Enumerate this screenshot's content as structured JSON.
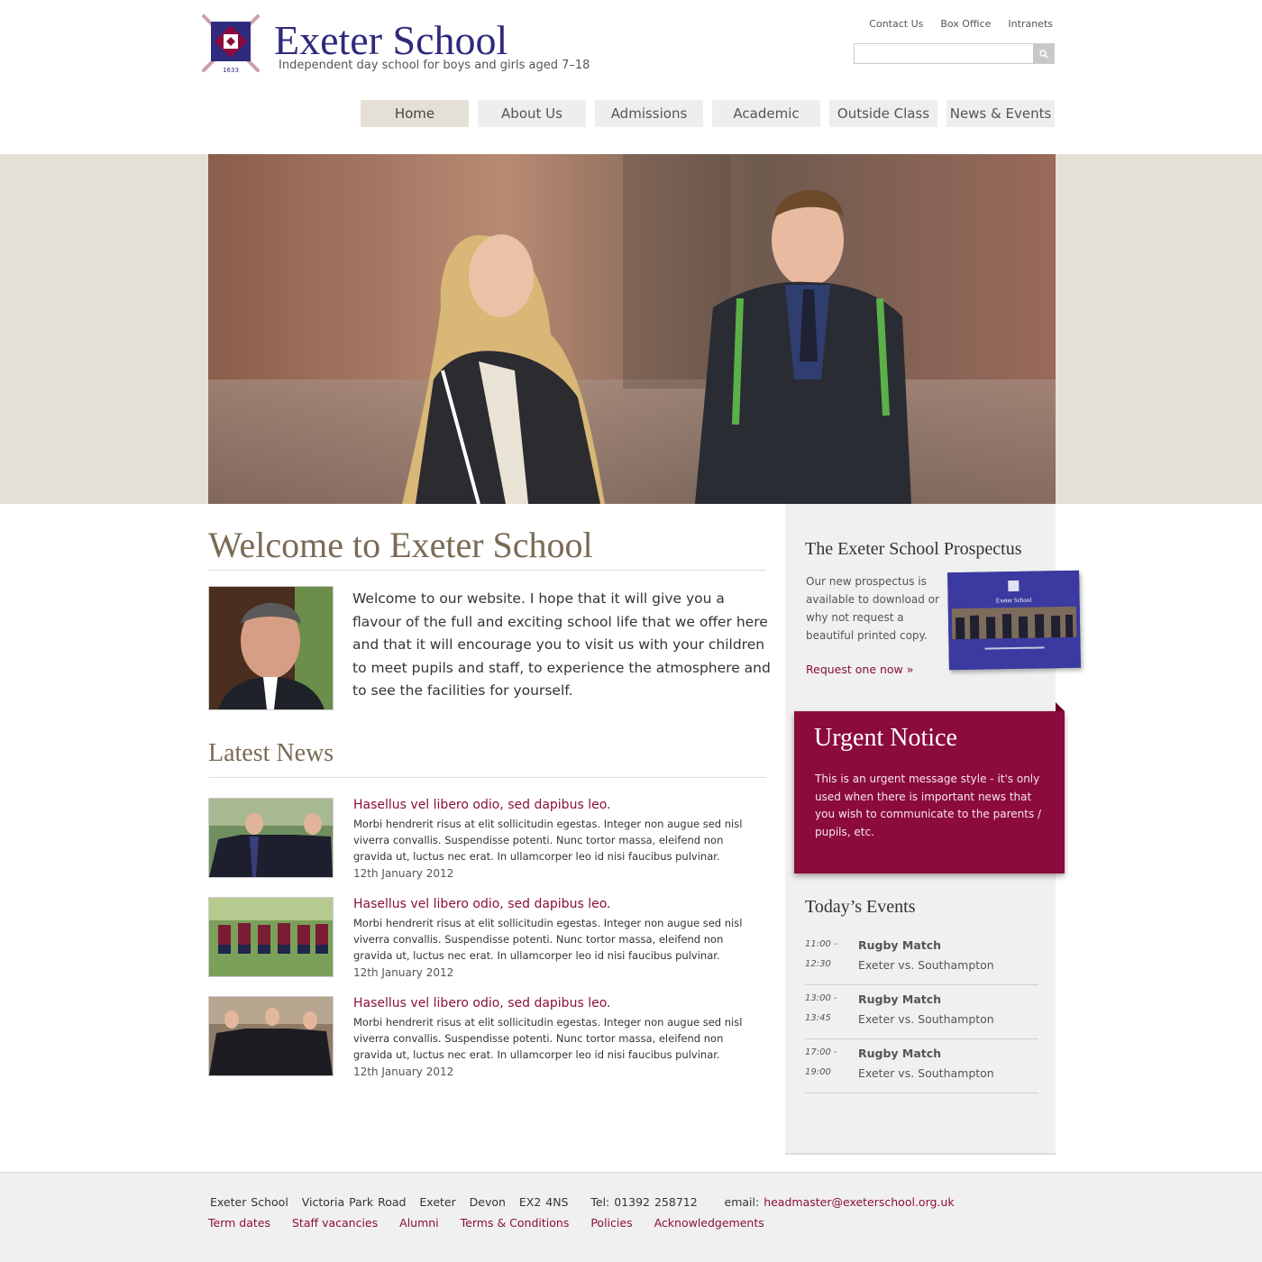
{
  "header": {
    "title": "Exeter School",
    "tagline": "Independent day school for boys and girls aged 7–18",
    "logo_year": "1633",
    "utility_links": [
      "Contact Us",
      "Box Office",
      "Intranets"
    ],
    "search": {
      "value": "",
      "placeholder": ""
    }
  },
  "nav": {
    "items": [
      "Home",
      "About Us",
      "Admissions",
      "Academic",
      "Outside Class",
      "News & Events"
    ],
    "active": "Home"
  },
  "welcome": {
    "title": "Welcome to Exeter School",
    "text": "Welcome to our website. I hope that it will give you a flavour of the full and exciting school life that we offer here and that it will encourage you to visit us with your children to meet pupils and staff, to experience the atmosphere and to see the facilities for yourself."
  },
  "news": {
    "title": "Latest News",
    "items": [
      {
        "headline": "Hasellus vel libero odio, sed dapibus leo.",
        "body": "Morbi hendrerit risus at elit sollicitudin egestas. Integer non augue sed nisl viverra convallis. Suspendisse potenti. Nunc tortor massa, eleifend non gravida ut, luctus nec erat. In ullamcorper leo id nisi faucibus pulvinar.",
        "date": "12th January 2012"
      },
      {
        "headline": "Hasellus vel libero odio, sed dapibus leo.",
        "body": "Morbi hendrerit risus at elit sollicitudin egestas. Integer non augue sed nisl viverra convallis. Suspendisse potenti. Nunc tortor massa, eleifend non gravida ut, luctus nec erat. In ullamcorper leo id nisi faucibus pulvinar.",
        "date": "12th January 2012"
      },
      {
        "headline": "Hasellus vel libero odio, sed dapibus leo.",
        "body": "Morbi hendrerit risus at elit sollicitudin egestas. Integer non augue sed nisl viverra convallis. Suspendisse potenti. Nunc tortor massa, eleifend non gravida ut, luctus nec erat. In ullamcorper leo id nisi faucibus pulvinar.",
        "date": "12th January 2012"
      }
    ]
  },
  "prospectus": {
    "title": "The Exeter School Prospectus",
    "text": "Our new prospectus is available to download or why not request a beautiful printed copy.",
    "link": "Request one now »",
    "cover_title": "Exeter School"
  },
  "urgent": {
    "title": "Urgent Notice",
    "text": "This is an urgent message style - it's only used when there is important news that you wish to communicate to the parents / pupils, etc."
  },
  "events": {
    "title": "Today’s Events",
    "items": [
      {
        "start": "11:00 -",
        "end": "12:30",
        "name": "Rugby Match",
        "desc": "Exeter vs. Southampton"
      },
      {
        "start": "13:00 -",
        "end": "13:45",
        "name": "Rugby Match",
        "desc": "Exeter vs. Southampton"
      },
      {
        "start": "17:00 -",
        "end": "19:00",
        "name": "Rugby Match",
        "desc": "Exeter vs. Southampton"
      }
    ]
  },
  "footer": {
    "address": "Exeter School   Victoria Park Road   Exeter   Devon   EX2 4NS     Tel: 01392 258712      email: ",
    "email": "headmaster@exeterschool.org.uk",
    "links": [
      "Term dates",
      "Staff vacancies",
      "Alumni",
      "Terms & Conditions",
      "Policies",
      "Acknowledgements"
    ]
  },
  "colors": {
    "brand_navy": "#2e2a7c",
    "accent_maroon": "#8b0b3c",
    "heading_brown": "#7a6a55",
    "hero_band": "#e5e0d5"
  },
  "icons": {
    "search": "magnifier-icon",
    "logo": "school-crest-icon"
  }
}
